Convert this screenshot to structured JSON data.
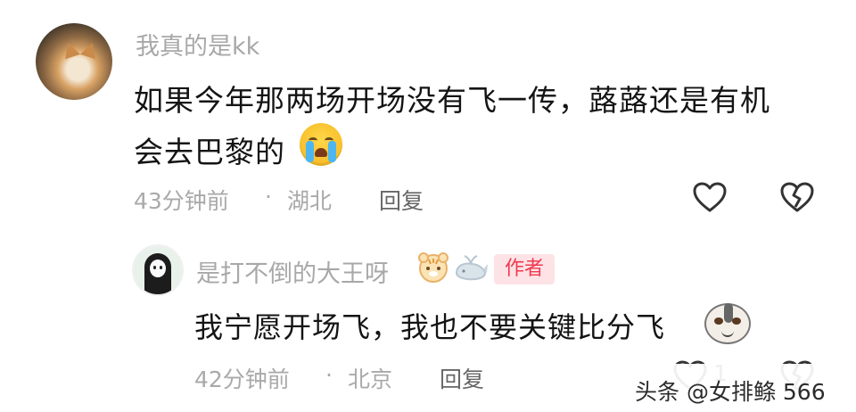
{
  "comment": {
    "username": "我真的是kk",
    "text_line1": "如果今年那两场开场没有飞一传，蕗蕗还是有机",
    "text_line2": "会去巴黎的",
    "time": "43分钟前",
    "location": "湖北",
    "reply_label": "回复"
  },
  "reply": {
    "username": "是打不倒的大王呀",
    "author_badge": "作者",
    "text": "我宁愿开场飞，我也不要关键比分飞",
    "time": "42分钟前",
    "location": "北京",
    "reply_label": "回复",
    "like_count": "1"
  },
  "separator": "·",
  "watermark": "头条 @女排鲦 566",
  "colors": {
    "meta_gray": "#a9a9a9",
    "author_badge_bg": "#fde3e6",
    "author_badge_text": "#f0394f"
  },
  "icons": [
    "heart-outline-icon",
    "broken-heart-icon",
    "crying-face-emoji",
    "dog-face-emoji",
    "tiger-sticker-icon",
    "whale-sticker-icon"
  ]
}
